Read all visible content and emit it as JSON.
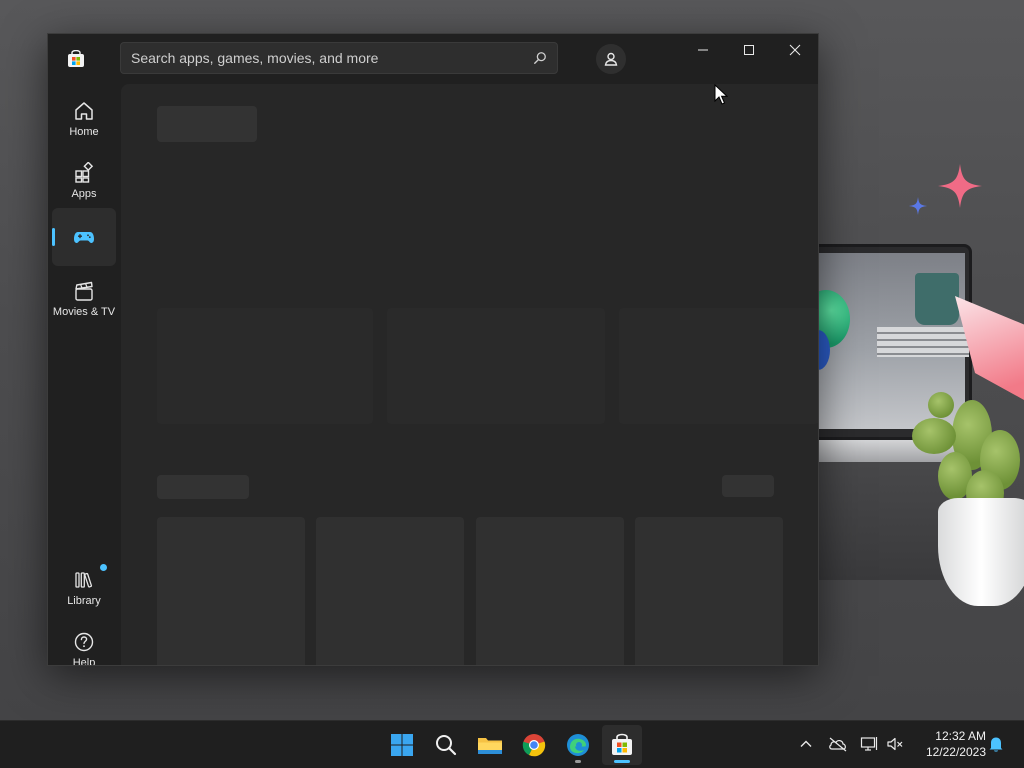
{
  "app": {
    "search_placeholder": "Search apps, games, movies, and more"
  },
  "nav": {
    "home_label": "Home",
    "apps_label": "Apps",
    "gaming_label": "",
    "movies_label": "Movies & TV",
    "library_label": "Library",
    "help_label": "Help"
  },
  "taskbar": {
    "time": "12:32 AM",
    "date": "12/22/2023"
  },
  "colors": {
    "accent": "#4cc2ff",
    "window_bg": "#202020",
    "content_bg": "#272727",
    "taskbar_bg": "#1f1f1f"
  },
  "icons": {
    "store": "microsoft-store-icon",
    "search": "search-icon",
    "account": "account-icon",
    "minimize": "minimize-icon",
    "maximize": "maximize-icon",
    "close": "close-icon",
    "home": "home-icon",
    "apps": "apps-icon",
    "gaming": "gamepad-icon",
    "movies": "clapperboard-icon",
    "library": "library-icon",
    "help": "help-icon"
  }
}
